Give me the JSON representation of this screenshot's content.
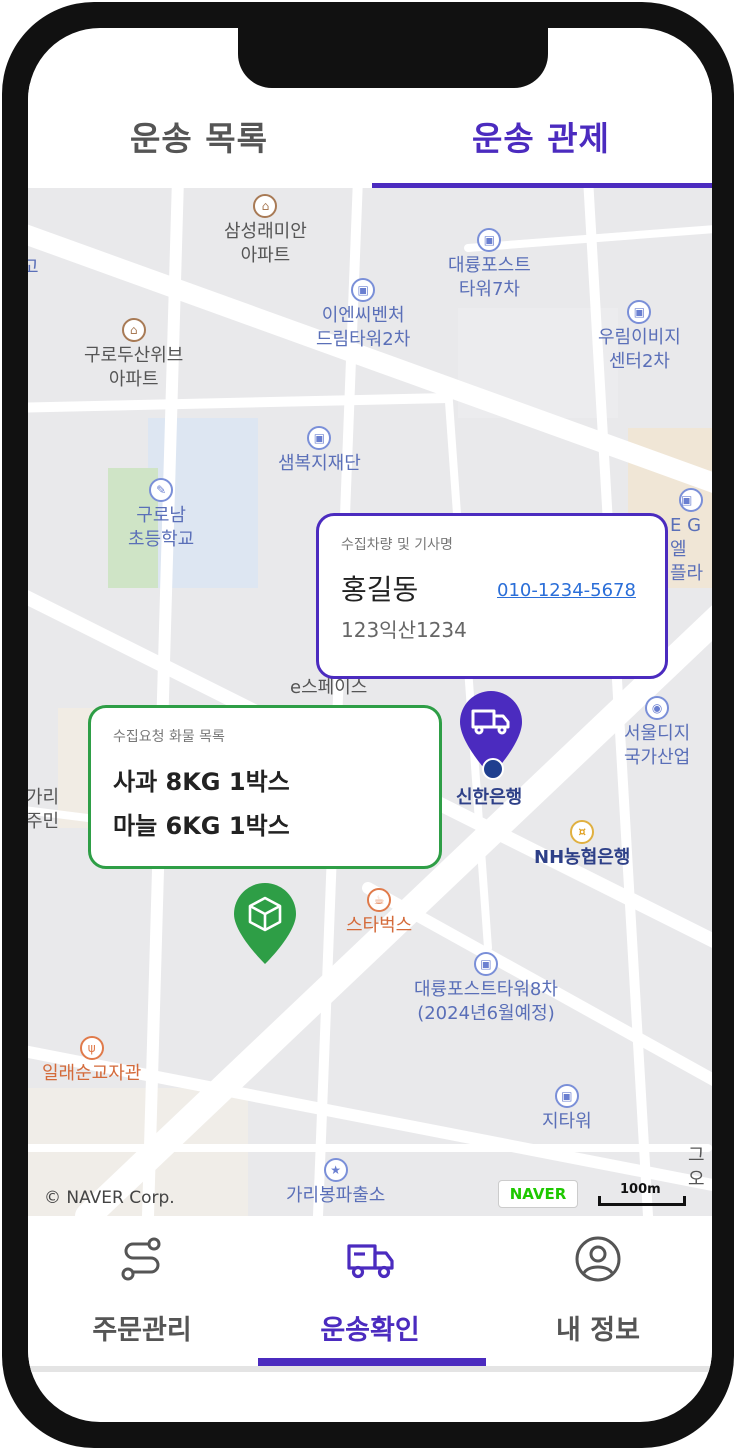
{
  "tabs": {
    "list_label": "운송 목록",
    "control_label": "운송 관제"
  },
  "map": {
    "pois": [
      "삼성래미안\n아파트",
      "대륭포스트\n타워7차",
      "이엔씨벤처\n드림타워2차",
      "우림이비지\n센터2차",
      "구로두산위브\n아파트",
      "샘복지재단",
      "구로남\n초등학교",
      "e스페이스",
      "서울디지\n국가산업",
      "신한은행",
      "NH농협은행",
      "스타벅스",
      "대륭포스트타워8차\n(2024년6월예정)",
      "일래순교자관",
      "지타워",
      "가리봉파출소",
      "가리\n주민",
      "E G엘\n플라",
      "고",
      "그\n오"
    ],
    "attribution": "© NAVER Corp.",
    "naver_logo": "NAVER",
    "scale": "100m"
  },
  "driver_popup": {
    "caption": "수집차량 및 기사명",
    "name": "홍길동",
    "phone": "010-1234-5678",
    "plate": "123익산1234"
  },
  "cargo_popup": {
    "caption": "수집요청 화물 목록",
    "items": [
      "사과 8KG 1박스",
      "마늘 6KG 1박스"
    ]
  },
  "bottom_nav": {
    "orders": "주문관리",
    "transport": "운송확인",
    "profile": "내 정보"
  },
  "colors": {
    "accent": "#4b2bbf",
    "cargo_green": "#2e9e46"
  }
}
